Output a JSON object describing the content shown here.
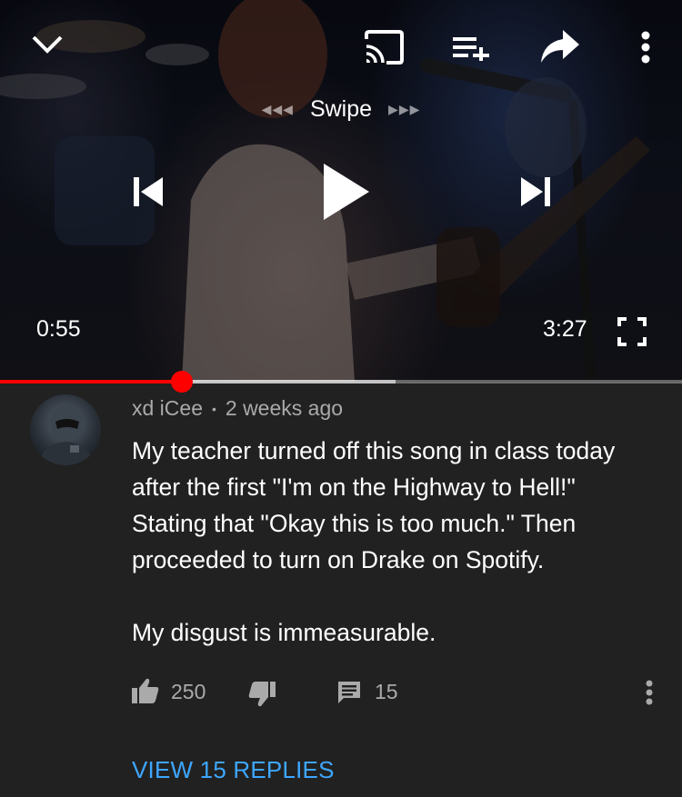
{
  "player": {
    "swipe_label": "Swipe",
    "swipe_left_arrows": "◀◀◀",
    "swipe_right_arrows": "▶▶▶",
    "current_time": "0:55",
    "duration": "3:27",
    "progress_fraction": 0.266,
    "buffered_fraction": 0.58,
    "accent_color": "#ff0000",
    "icons": [
      "chevron-down-icon",
      "cast-icon",
      "add-to-queue-icon",
      "share-icon",
      "more-vert-icon",
      "previous-icon",
      "play-icon",
      "next-icon",
      "fullscreen-icon"
    ]
  },
  "comment": {
    "author": "xd iCee",
    "separator": "•",
    "timestamp": "2 weeks ago",
    "lines": [
      "My teacher turned off this song in class today",
      "after the first \"I'm on the Highway to Hell!\"",
      "Stating that \"Okay this is too much.\" Then",
      "proceeded to turn on Drake on Spotify."
    ],
    "closing_line": "My disgust is immeasurable.",
    "likes": "250",
    "replies_count": "15",
    "view_replies_label": "VIEW 15 REPLIES",
    "link_color": "#3ea6ff"
  }
}
